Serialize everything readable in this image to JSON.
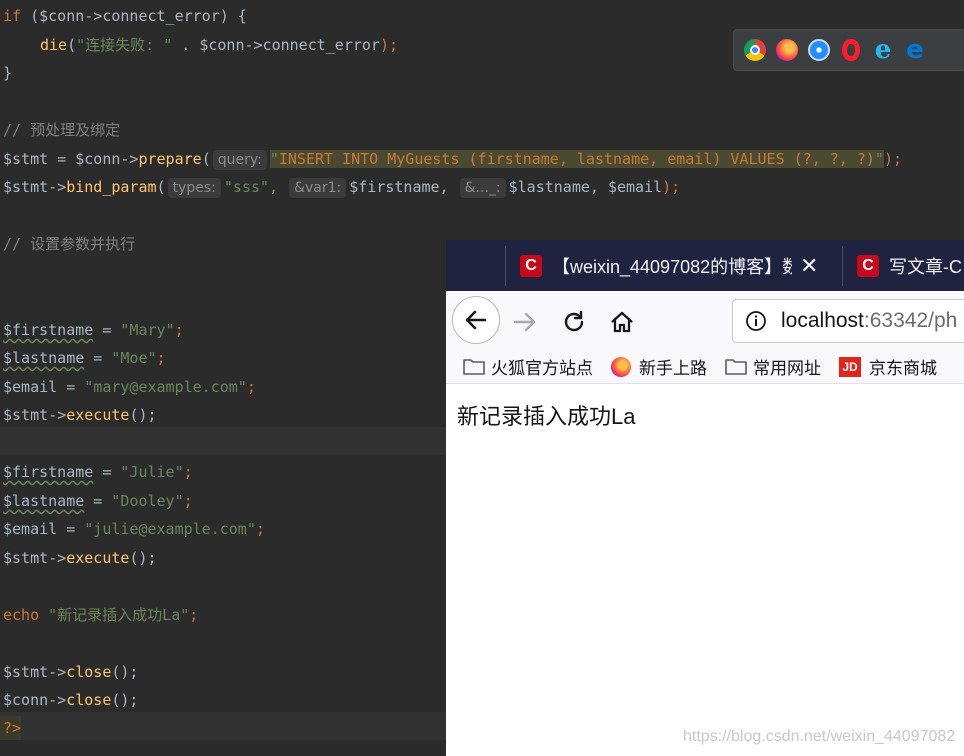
{
  "editor": {
    "line1": {
      "kw": "if",
      "rest": " ($conn->connect_error) {"
    },
    "line2": {
      "fn": "die",
      "str": "\"连接失败: \"",
      "rest": " . $conn->connect_error",
      "end": ");"
    },
    "line3": "}",
    "comment1": "// 预处理及绑定",
    "line5": {
      "var": "$stmt",
      "eq": " = $conn->",
      "fn": "prepare",
      "open": "(",
      "hint": "query:",
      "str_open": "\"",
      "sql": "INSERT INTO MyGuests (firstname, lastname, email) VALUES (?, ?, ?)",
      "str_close": "\"",
      "end": ");"
    },
    "line6": {
      "var": "$stmt->",
      "fn": "bind_param",
      "open": "(",
      "hint1": "types:",
      "str": "\"sss\"",
      "comma1": ",",
      "hint2": "&var1:",
      "v1": "$firstname,",
      "hint3": "&..._:",
      "v2": "$lastname, $email",
      "end": ");"
    },
    "comment2": "// 设置参数并执行",
    "line9": {
      "var": "$firstname",
      "eq": " = ",
      "str": "\"Mary\"",
      "end": ";"
    },
    "line10": {
      "var": "$lastname",
      "eq": " = ",
      "str": "\"Moe\"",
      "end": ";"
    },
    "line11": {
      "var": "$email",
      "eq": " = ",
      "str": "\"mary@example.com\"",
      "end": ";"
    },
    "line12": {
      "var": "$stmt->",
      "fn": "execute",
      "end": "();"
    },
    "line14": {
      "var": "$firstname",
      "eq": " = ",
      "str": "\"Julie\"",
      "end": ";"
    },
    "line15": {
      "var": "$lastname",
      "eq": " = ",
      "str": "\"Dooley\"",
      "end": ";"
    },
    "line16": {
      "var": "$email",
      "eq": " = ",
      "str": "\"julie@example.com\"",
      "end": ";"
    },
    "line17": {
      "var": "$stmt->",
      "fn": "execute",
      "end": "();"
    },
    "line19": {
      "kw": "echo",
      "str": " \"新记录插入成功La\"",
      "end": ";"
    },
    "line21": {
      "var": "$stmt->",
      "fn": "close",
      "end": "();"
    },
    "line22": {
      "var": "$conn->",
      "fn": "close",
      "end": "();"
    },
    "line23": "?>"
  },
  "browser_chooser": {
    "icons": [
      "chrome-icon",
      "firefox-icon",
      "safari-icon",
      "opera-icon",
      "ie-icon",
      "edge-icon"
    ]
  },
  "firefox": {
    "tabs": [
      {
        "title": "【weixin_44097082的博客】数"
      },
      {
        "title": "写文章-C"
      }
    ],
    "url": {
      "host": "localhost",
      "rest": ":63342/ph"
    },
    "bookmarks": [
      "火狐官方站点",
      "新手上路",
      "常用网址",
      "京东商城"
    ],
    "page_text": "新记录插入成功La"
  },
  "watermark": "https://blog.csdn.net/weixin_44097082",
  "colors": {
    "editor_bg": "#2b2b2b",
    "keyword": "#cc7832",
    "function": "#ffc66d",
    "string": "#6a8759",
    "comment": "#808080",
    "tabbar": "#202340",
    "csdn_red": "#c7091a"
  }
}
